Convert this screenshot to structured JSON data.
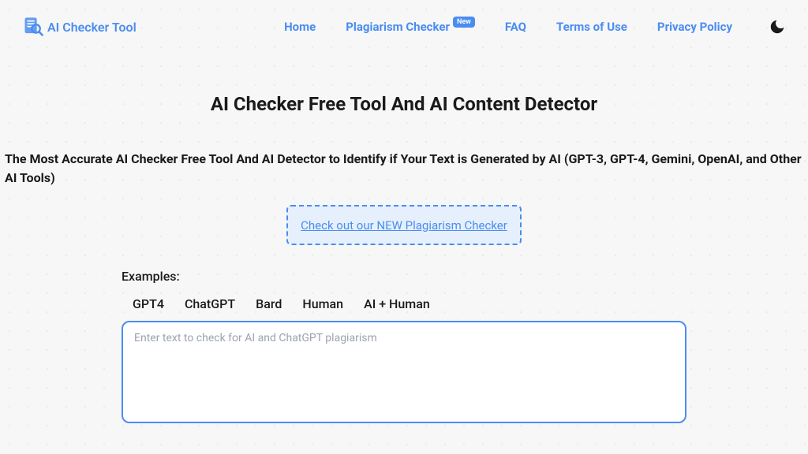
{
  "header": {
    "logo_text": "AI Checker Tool",
    "nav": {
      "home": "Home",
      "plagiarism": "Plagiarism Checker",
      "plagiarism_badge": "New",
      "faq": "FAQ",
      "terms": "Terms of Use",
      "privacy": "Privacy Policy"
    }
  },
  "main": {
    "title": "AI Checker Free Tool And AI Content Detector",
    "subtitle": "The Most Accurate AI Checker Free Tool And AI Detector to Identify if Your Text is Generated by AI (GPT-3, GPT-4, Gemini, OpenAI, and Other AI Tools)",
    "promo_link": "Check out our NEW Plagiarism Checker",
    "examples_label": "Examples:",
    "tabs": {
      "gpt4": "GPT4",
      "chatgpt": "ChatGPT",
      "bard": "Bard",
      "human": "Human",
      "ai_human": "AI + Human"
    },
    "textarea_placeholder": "Enter text to check for AI and ChatGPT plagiarism"
  }
}
